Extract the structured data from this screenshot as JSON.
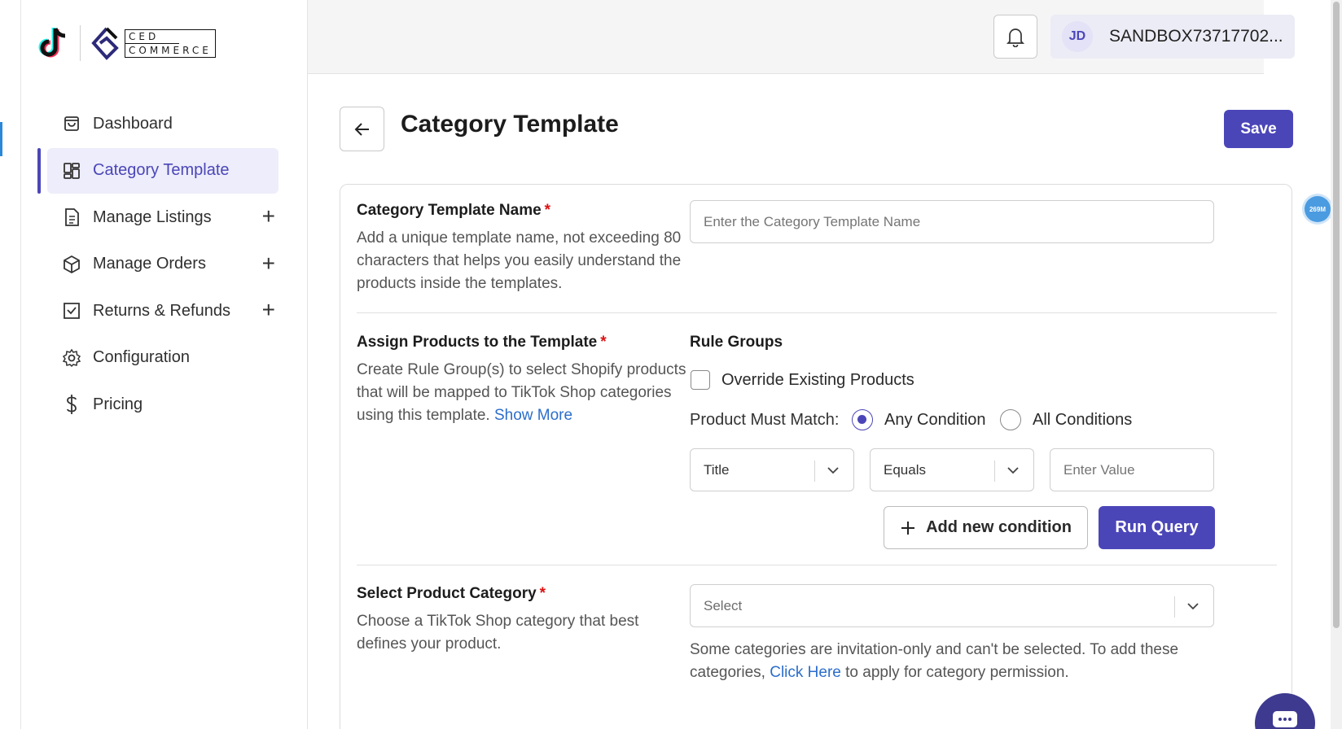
{
  "brand": {
    "ced_line1": "CED",
    "ced_line2": "COMMERCE"
  },
  "sidebar": {
    "items": [
      {
        "label": "Dashboard",
        "icon": "bag-icon",
        "expandable": false
      },
      {
        "label": "Category Template",
        "icon": "grid-layout-icon",
        "expandable": false,
        "active": true
      },
      {
        "label": "Manage Listings",
        "icon": "document-icon",
        "expandable": true
      },
      {
        "label": "Manage Orders",
        "icon": "box-icon",
        "expandable": true
      },
      {
        "label": "Returns & Refunds",
        "icon": "return-box-icon",
        "expandable": true
      },
      {
        "label": "Configuration",
        "icon": "gear-icon",
        "expandable": false
      },
      {
        "label": "Pricing",
        "icon": "dollar-icon",
        "expandable": false
      }
    ],
    "plus_symbol": "+"
  },
  "topbar": {
    "avatar_initials": "JD",
    "user_name": "SANDBOX73717702..."
  },
  "page": {
    "title": "Category Template",
    "save_label": "Save"
  },
  "template_name": {
    "label": "Category Template Name",
    "required_mark": "*",
    "description": "Add a unique template name, not exceeding 80 characters that helps you easily understand the products inside the templates.",
    "placeholder": "Enter the Category Template Name"
  },
  "assign_products": {
    "label": "Assign Products to the Template",
    "required_mark": "*",
    "description": "Create Rule Group(s) to select Shopify products that will be mapped to TikTok Shop categories using this template.",
    "show_more": "Show More",
    "rule_groups_title": "Rule Groups",
    "override_label": "Override Existing Products",
    "must_match_label": "Product Must Match:",
    "any_condition": "Any Condition",
    "all_conditions": "All Conditions",
    "selected_match": "Any Condition",
    "condition": {
      "field": "Title",
      "operator": "Equals",
      "value_placeholder": "Enter Value"
    },
    "add_condition_label": "Add new condition",
    "run_query_label": "Run Query"
  },
  "product_category": {
    "label": "Select Product Category",
    "required_mark": "*",
    "description": "Choose a TikTok Shop category that best defines your product.",
    "select_placeholder": "Select",
    "note_before": "Some categories are invitation-only and can't be selected. To add these categories,",
    "note_link": "Click Here",
    "note_after": "to apply for category permission."
  },
  "badge": {
    "memory": "269M"
  },
  "colors": {
    "accent": "#4b46b8",
    "link": "#2c6ecb",
    "required": "#dd1111"
  }
}
